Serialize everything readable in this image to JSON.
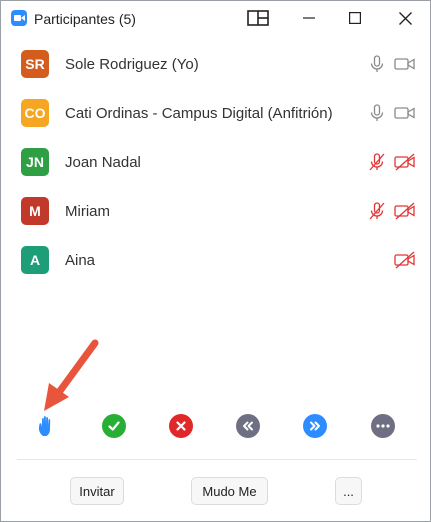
{
  "window": {
    "title": "Participantes (5)",
    "app_icon": "zoom-camera-icon",
    "controls": [
      "layout-icon",
      "minimize-icon",
      "maximize-icon",
      "close-icon"
    ]
  },
  "participants": [
    {
      "initials": "SR",
      "name": "Sole Rodriguez (Yo)",
      "avatar_color": "#d45d1e",
      "mic": "on",
      "video": "on"
    },
    {
      "initials": "CO",
      "name": "Cati Ordinas - Campus Digital (Anfitrión)",
      "avatar_color": "#f5a623",
      "mic": "on",
      "video": "on"
    },
    {
      "initials": "JN",
      "name": "Joan Nadal",
      "avatar_color": "#2ea043",
      "mic": "muted",
      "video": "off"
    },
    {
      "initials": "M",
      "name": "Miriam",
      "avatar_color": "#c0392b",
      "mic": "muted",
      "video": "off"
    },
    {
      "initials": "A",
      "name": "Aina",
      "avatar_color": "#1e9e78",
      "mic": "none",
      "video": "off"
    }
  ],
  "reactions": [
    {
      "icon": "raise-hand-icon",
      "color": "#2d8cff"
    },
    {
      "icon": "check-icon",
      "color": "#27ae35"
    },
    {
      "icon": "x-icon",
      "color": "#e02828"
    },
    {
      "icon": "rewind-icon",
      "color": "#6e6f82"
    },
    {
      "icon": "fast-forward-icon",
      "color": "#2d8cff"
    },
    {
      "icon": "more-icon",
      "color": "#6e6f82"
    }
  ],
  "footer": {
    "invite_label": "Invitar",
    "mute_me_label": "Mudo Me",
    "more_label": "..."
  },
  "colors": {
    "muted_red": "#e23636",
    "icon_gray": "#8a8a8a",
    "annotation_arrow": "#e8553c"
  }
}
